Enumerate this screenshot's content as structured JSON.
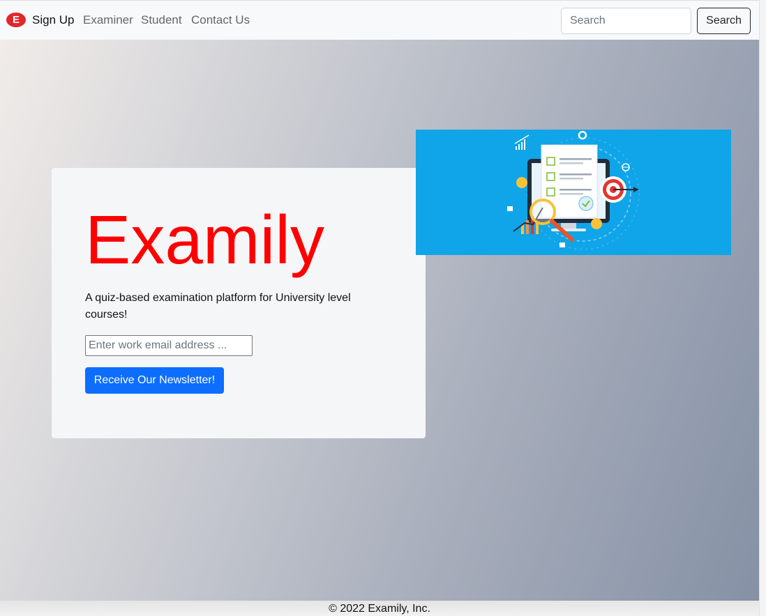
{
  "navbar": {
    "brand_letter": "E",
    "links": [
      {
        "label": "Sign Up",
        "active": true
      },
      {
        "label": "Examiner",
        "active": false
      },
      {
        "label": "Student",
        "active": false
      },
      {
        "label": "Contact Us",
        "active": false
      }
    ],
    "search": {
      "placeholder": "Search",
      "button_label": "Search"
    }
  },
  "hero": {
    "title": "Examily",
    "description": "A quiz-based examination platform for University level courses!",
    "email_placeholder": "Enter work email address ...",
    "newsletter_button": "Receive Our Newsletter!",
    "illustration_icon": "quiz-checklist-illustration"
  },
  "footer": {
    "text": "© 2022 Examily, Inc."
  },
  "colors": {
    "brand_red": "#e3252c",
    "title_red": "#fe0000",
    "primary_blue": "#0d6efd",
    "illustration_blue": "#10a5e8"
  }
}
